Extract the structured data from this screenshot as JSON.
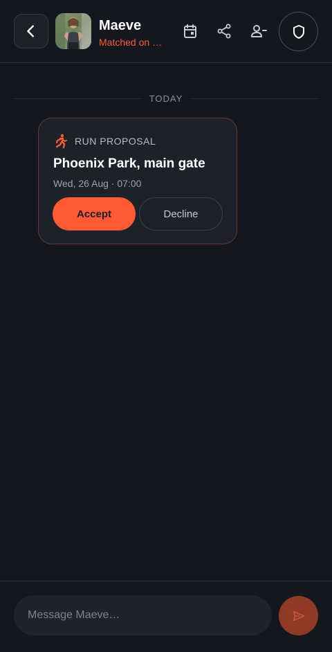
{
  "header": {
    "back_icon": "chevron-left-icon",
    "contact_name": "Maeve",
    "subtitle": "Matched on C…",
    "actions": [
      {
        "id": "schedule",
        "icon": "calendar-icon"
      },
      {
        "id": "share",
        "icon": "share-icon"
      },
      {
        "id": "unmatch",
        "icon": "user-minus-icon"
      },
      {
        "id": "safety",
        "icon": "shield-icon"
      }
    ]
  },
  "divider": {
    "label": "TODAY"
  },
  "proposal": {
    "icon": "running-icon",
    "kicker": "RUN PROPOSAL",
    "location": "Phoenix Park, main gate",
    "datetime": "Wed, 26 Aug · 07:00",
    "accept_label": "Accept",
    "decline_label": "Decline"
  },
  "composer": {
    "placeholder": "Message Maeve…",
    "value": "",
    "send_icon": "send-icon"
  },
  "colors": {
    "background": "#14171d",
    "accent": "#ff5a35",
    "card": "#1d2129",
    "send_disabled": "#8e3a25"
  }
}
